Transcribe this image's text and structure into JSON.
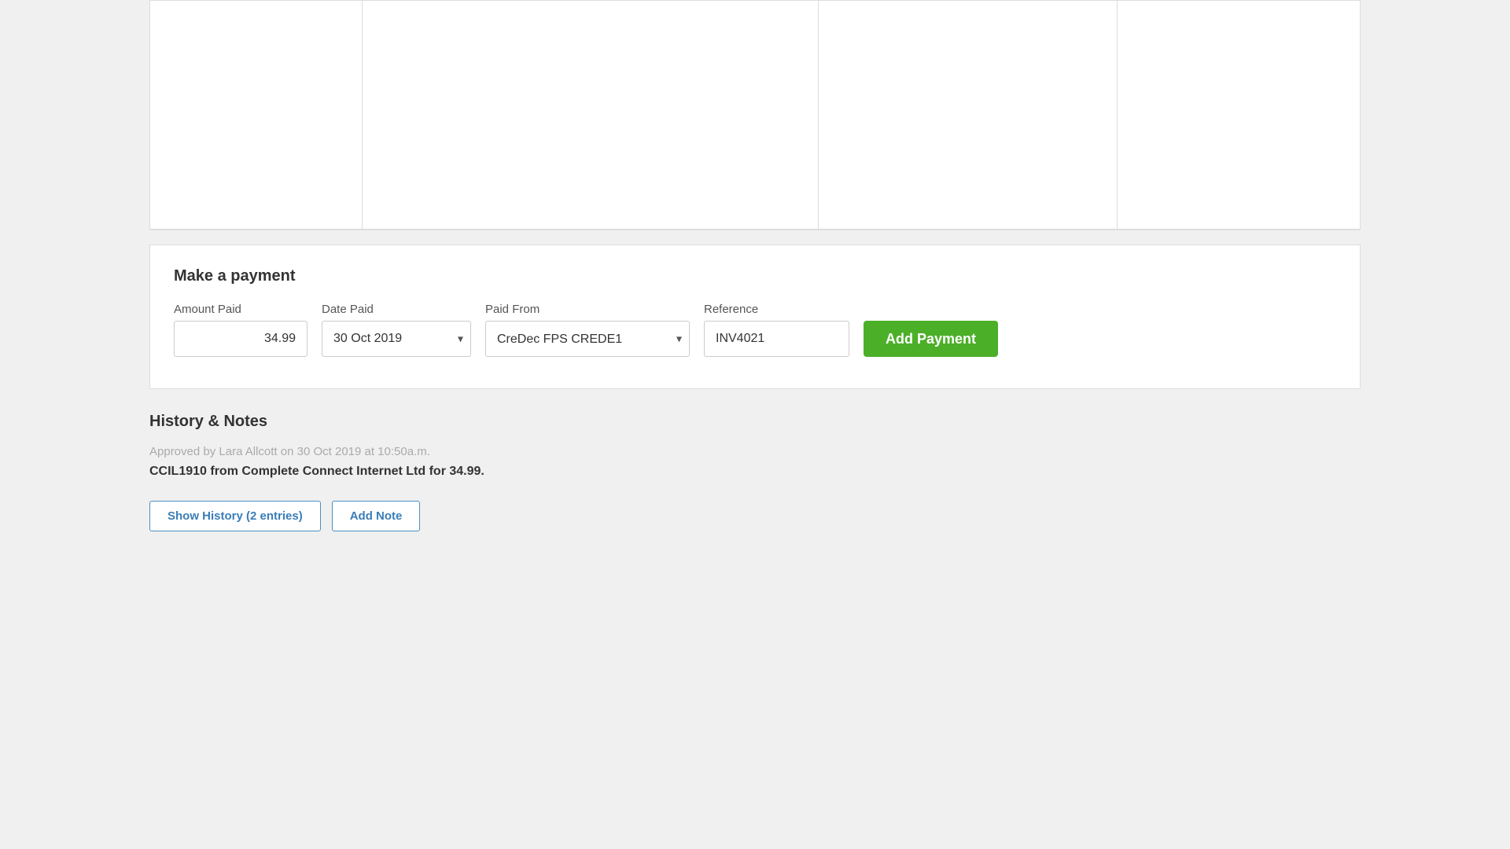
{
  "table": {
    "cells": [
      "",
      "",
      "",
      ""
    ]
  },
  "payment": {
    "section_title": "Make a payment",
    "amount_label": "Amount Paid",
    "amount_value": "34.99",
    "date_label": "Date Paid",
    "date_value": "30 Oct 2019",
    "paid_from_label": "Paid From",
    "paid_from_value": "CreDec FPS CREDE1",
    "paid_from_options": [
      "CreDec FPS CREDE1"
    ],
    "reference_label": "Reference",
    "reference_value": "INV4021",
    "add_payment_label": "Add Payment"
  },
  "history": {
    "section_title": "History & Notes",
    "note_text": "Approved by Lara Allcott on 30 Oct 2019 at 10:50a.m.",
    "main_text": "CCIL1910 from Complete Connect Internet Ltd for 34.99.",
    "show_history_label": "Show History (2 entries)",
    "add_note_label": "Add Note"
  },
  "icons": {
    "chevron_down": "▾"
  }
}
